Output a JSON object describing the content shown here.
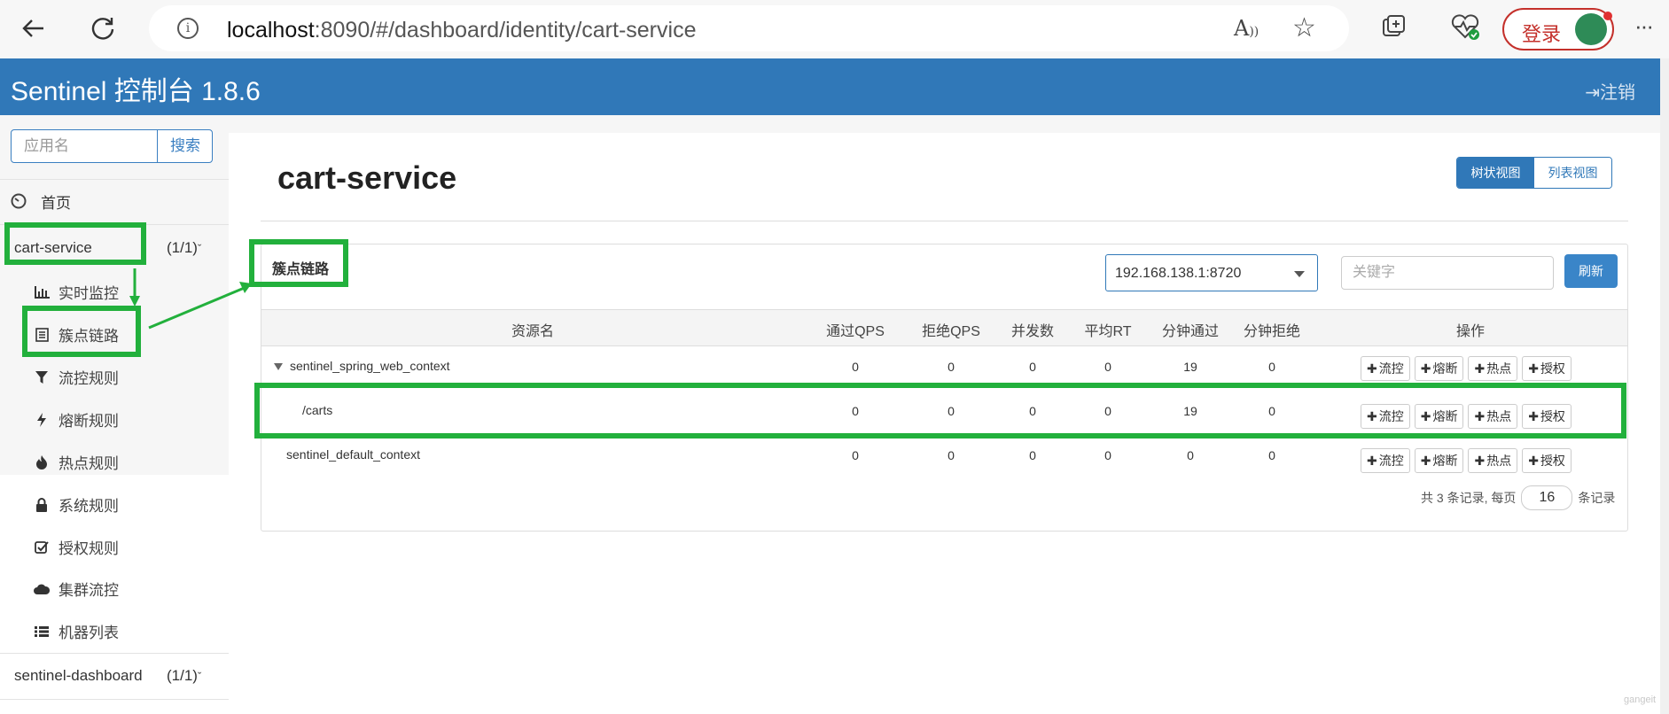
{
  "browser": {
    "url_host": "localhost",
    "url_rest": ":8090/#/dashboard/identity/cart-service",
    "login_label": "登录",
    "more": "···"
  },
  "app": {
    "title": "Sentinel 控制台 1.8.6",
    "logout": "注销"
  },
  "sidebar": {
    "search_placeholder": "应用名",
    "search_button": "搜索",
    "home": "首页",
    "app_group": {
      "name": "cart-service",
      "count": "(1/1)"
    },
    "items": [
      {
        "label": "实时监控",
        "icon": "bar-chart-icon"
      },
      {
        "label": "簇点链路",
        "icon": "list-icon"
      },
      {
        "label": "流控规则",
        "icon": "filter-icon"
      },
      {
        "label": "熔断规则",
        "icon": "flash-icon"
      },
      {
        "label": "热点规则",
        "icon": "fire-icon"
      },
      {
        "label": "系统规则",
        "icon": "lock-icon"
      },
      {
        "label": "授权规则",
        "icon": "check-icon"
      },
      {
        "label": "集群流控",
        "icon": "cloud-icon"
      },
      {
        "label": "机器列表",
        "icon": "list-lines-icon"
      }
    ],
    "app_group2": {
      "name": "sentinel-dashboard",
      "count": "(1/1)"
    }
  },
  "main": {
    "page_title": "cart-service",
    "view_tree": "树状视图",
    "view_list": "列表视图",
    "panel_label": "簇点链路",
    "machine_select": "192.168.138.1:8720",
    "keyword_placeholder": "关键字",
    "refresh": "刷新",
    "columns": [
      "资源名",
      "通过QPS",
      "拒绝QPS",
      "并发数",
      "平均RT",
      "分钟通过",
      "分钟拒绝",
      "操作"
    ],
    "rows": [
      {
        "name": "sentinel_spring_web_context",
        "values": [
          "0",
          "0",
          "0",
          "0",
          "19",
          "0"
        ]
      },
      {
        "name": "/carts",
        "values": [
          "0",
          "0",
          "0",
          "0",
          "19",
          "0"
        ]
      },
      {
        "name": "sentinel_default_context",
        "values": [
          "0",
          "0",
          "0",
          "0",
          "0",
          "0"
        ]
      }
    ],
    "ops": [
      "流控",
      "熔断",
      "热点",
      "授权"
    ],
    "pager_prefix": "共 3 条记录, 每页",
    "page_size": "16",
    "pager_suffix": "条记录"
  },
  "watermark": "gangeit",
  "colors": {
    "header": "#3078b8",
    "annotation": "#22b03c"
  }
}
